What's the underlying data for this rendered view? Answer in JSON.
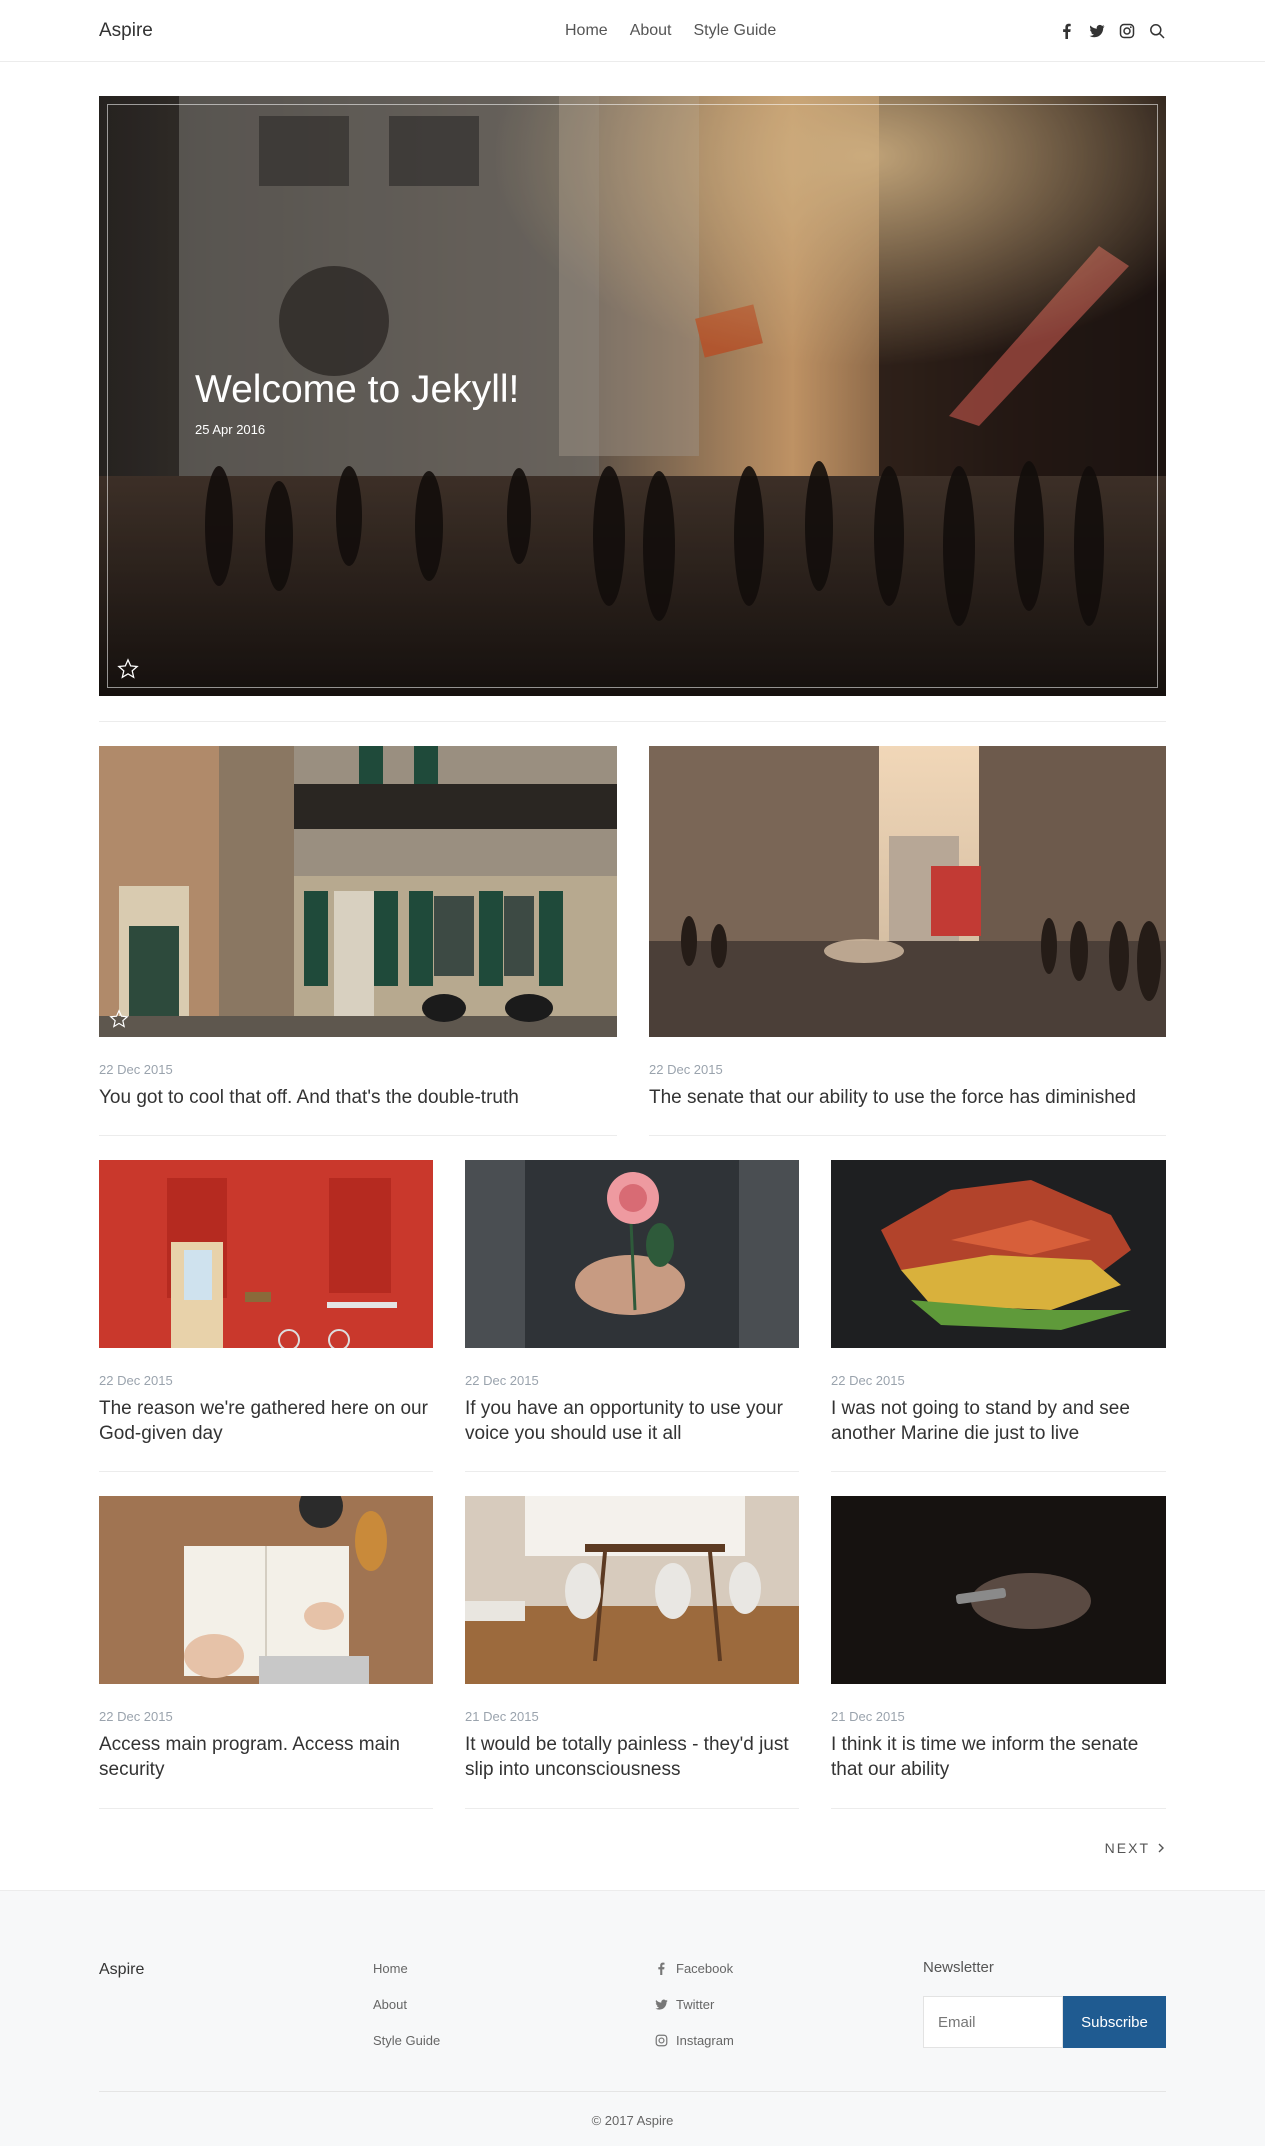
{
  "header": {
    "brand": "Aspire",
    "nav": [
      "Home",
      "About",
      "Style Guide"
    ]
  },
  "hero": {
    "title": "Welcome to Jekyll!",
    "date": "25 Apr 2016"
  },
  "posts_row1": [
    {
      "date": "22 Dec 2015",
      "title": "You got to cool that off. And that's the double-truth"
    },
    {
      "date": "22 Dec 2015",
      "title": "The senate that our ability to use the force has diminished"
    }
  ],
  "posts_row2": [
    {
      "date": "22 Dec 2015",
      "title": "The reason we're gathered here on our God-given day"
    },
    {
      "date": "22 Dec 2015",
      "title": "If you have an opportunity to use your voice you should use it all"
    },
    {
      "date": "22 Dec 2015",
      "title": "I was not going to stand by and see another Marine die just to live"
    }
  ],
  "posts_row3": [
    {
      "date": "22 Dec 2015",
      "title": "Access main program. Access main security"
    },
    {
      "date": "21 Dec 2015",
      "title": "It would be totally painless - they'd just slip into unconsciousness"
    },
    {
      "date": "21 Dec 2015",
      "title": "I think it is time we inform the senate that our ability"
    }
  ],
  "pagination": {
    "next": "NEXT"
  },
  "footer": {
    "brand": "Aspire",
    "links": [
      "Home",
      "About",
      "Style Guide"
    ],
    "social": [
      "Facebook",
      "Twitter",
      "Instagram"
    ],
    "newsletter_label": "Newsletter",
    "email_placeholder": "Email",
    "subscribe": "Subscribe",
    "copyright": "© 2017 Aspire"
  },
  "colors": {
    "accent": "#1f5b91",
    "date": "#9aa3ad"
  }
}
